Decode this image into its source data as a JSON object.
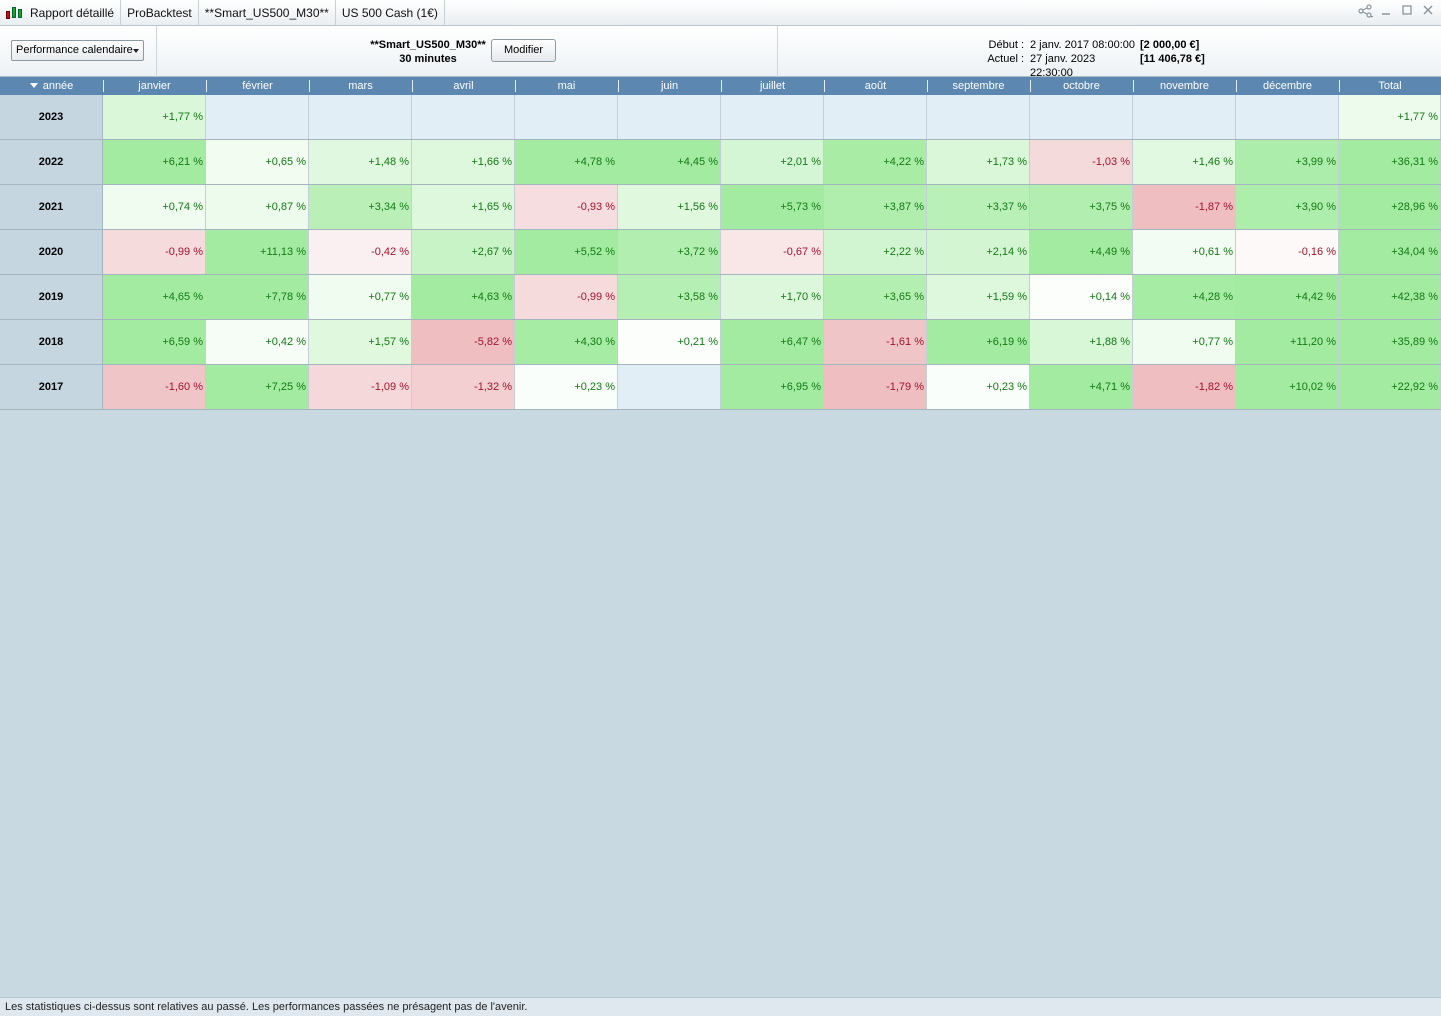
{
  "titlebar": {
    "breadcrumbs": [
      "Rapport détaillé",
      "ProBacktest",
      "**Smart_US500_M30**",
      "US 500 Cash (1€)"
    ]
  },
  "toolbar": {
    "view_select": "Performance calendaire",
    "strategy_name": "**Smart_US500_M30**",
    "timeframe": "30 minutes",
    "modify_label": "Modifier",
    "start_label": "Début :",
    "start_date": "2 janv. 2017 08:00:00",
    "start_value": "[2 000,00 €]",
    "current_label": "Actuel :",
    "current_date": "27 janv. 2023 22:30:00",
    "current_value": "[11 406,78 €]"
  },
  "table": {
    "year_header": "année",
    "columns": [
      "janvier",
      "février",
      "mars",
      "avril",
      "mai",
      "juin",
      "juillet",
      "août",
      "septembre",
      "octobre",
      "novembre",
      "décembre",
      "Total"
    ],
    "rows": [
      {
        "year": "2023",
        "cells": [
          "+1,77 %",
          "",
          "",
          "",
          "",
          "",
          "",
          "",
          "",
          "",
          "",
          "",
          "+1,77 %"
        ]
      },
      {
        "year": "2022",
        "cells": [
          "+6,21 %",
          "+0,65 %",
          "+1,48 %",
          "+1,66 %",
          "+4,78 %",
          "+4,45 %",
          "+2,01 %",
          "+4,22 %",
          "+1,73 %",
          "-1,03 %",
          "+1,46 %",
          "+3,99 %",
          "+36,31 %"
        ]
      },
      {
        "year": "2021",
        "cells": [
          "+0,74 %",
          "+0,87 %",
          "+3,34 %",
          "+1,65 %",
          "-0,93 %",
          "+1,56 %",
          "+5,73 %",
          "+3,87 %",
          "+3,37 %",
          "+3,75 %",
          "-1,87 %",
          "+3,90 %",
          "+28,96 %"
        ]
      },
      {
        "year": "2020",
        "cells": [
          "-0,99 %",
          "+11,13 %",
          "-0,42 %",
          "+2,67 %",
          "+5,52 %",
          "+3,72 %",
          "-0,67 %",
          "+2,22 %",
          "+2,14 %",
          "+4,49 %",
          "+0,61 %",
          "-0,16 %",
          "+34,04 %"
        ]
      },
      {
        "year": "2019",
        "cells": [
          "+4,65 %",
          "+7,78 %",
          "+0,77 %",
          "+4,63 %",
          "-0,99 %",
          "+3,58 %",
          "+1,70 %",
          "+3,65 %",
          "+1,59 %",
          "+0,14 %",
          "+4,28 %",
          "+4,42 %",
          "+42,38 %"
        ]
      },
      {
        "year": "2018",
        "cells": [
          "+6,59 %",
          "+0,42 %",
          "+1,57 %",
          "-5,82 %",
          "+4,30 %",
          "+0,21 %",
          "+6,47 %",
          "-1,61 %",
          "+6,19 %",
          "+1,88 %",
          "+0,77 %",
          "+11,20 %",
          "+35,89 %"
        ]
      },
      {
        "year": "2017",
        "cells": [
          "-1,60 %",
          "+7,25 %",
          "-1,09 %",
          "-1,32 %",
          "+0,23 %",
          "",
          "+6,95 %",
          "-1,79 %",
          "+0,23 %",
          "+4,71 %",
          "-1,82 %",
          "+10,02 %",
          "+22,92 %"
        ]
      }
    ]
  },
  "colors": {
    "header_bg": "#5c87b0",
    "positive_text": "#137a13",
    "negative_text": "#a3142a",
    "empty_cell": "#e1eef6"
  },
  "footer": {
    "disclaimer": "Les statistiques ci-dessus sont relatives au passé. Les performances passées ne présagent pas de l'avenir."
  }
}
